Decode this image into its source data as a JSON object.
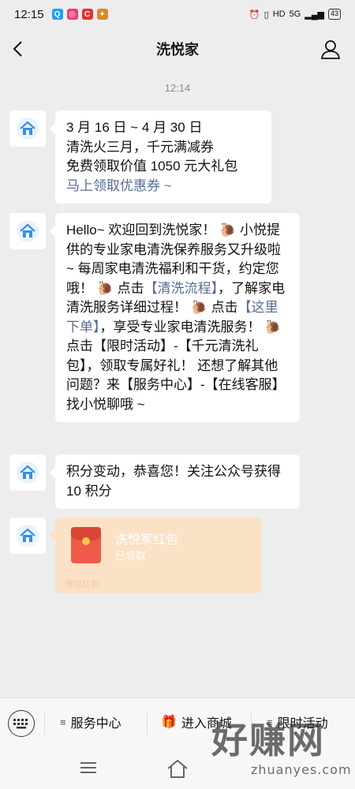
{
  "status_bar": {
    "time": "12:15",
    "network": "5G",
    "battery": "43"
  },
  "header": {
    "title": "洗悦家"
  },
  "chat": {
    "timestamp": "12:14",
    "messages": [
      {
        "lines": [
          "3 月 16 日 ~ 4 月 30 日",
          "清洗火三月，千元满减券",
          "免费领取价值 1050 元大礼包"
        ],
        "link": "马上领取优惠券 ~"
      },
      {
        "lines": [
          "Hello~ 欢迎回到洗悦家！",
          "小悦提供的专业家电清洗保养服务又升级啦 ~ 每周家电清洗福利和干货，约定您哦！",
          "点击",
          "【清洗流程】",
          "，了解家电清洗服务详细过程！",
          "点击",
          "【这里下单】",
          "，享受专业家电清洗服务！",
          "点击【限时活动】-【千元清洗礼包】，领取专属好礼！ 还想了解其他问题？来【服务中心】-【在线客服】找小悦聊哦 ~"
        ]
      },
      {
        "text": "积分变动，恭喜您！关注公众号获得 10 积分"
      },
      {
        "red_packet": {
          "title": "洗悦家红包",
          "status": "已领取",
          "label": "微信红包"
        }
      }
    ]
  },
  "menu": {
    "items": [
      {
        "label": "服务中心"
      },
      {
        "label": "进入商城"
      },
      {
        "label": "限时活动"
      }
    ]
  },
  "watermark": {
    "big": "好赚网",
    "small": "zhuanyes.com"
  },
  "icons": {
    "back": "back-arrow-icon",
    "profile": "person-icon",
    "avatar": "house-icon",
    "snail": "snail-emoji-icon",
    "gift": "gift-icon",
    "keyboard": "keyboard-icon",
    "hamburger": "hamburger-icon",
    "home": "home-icon"
  }
}
